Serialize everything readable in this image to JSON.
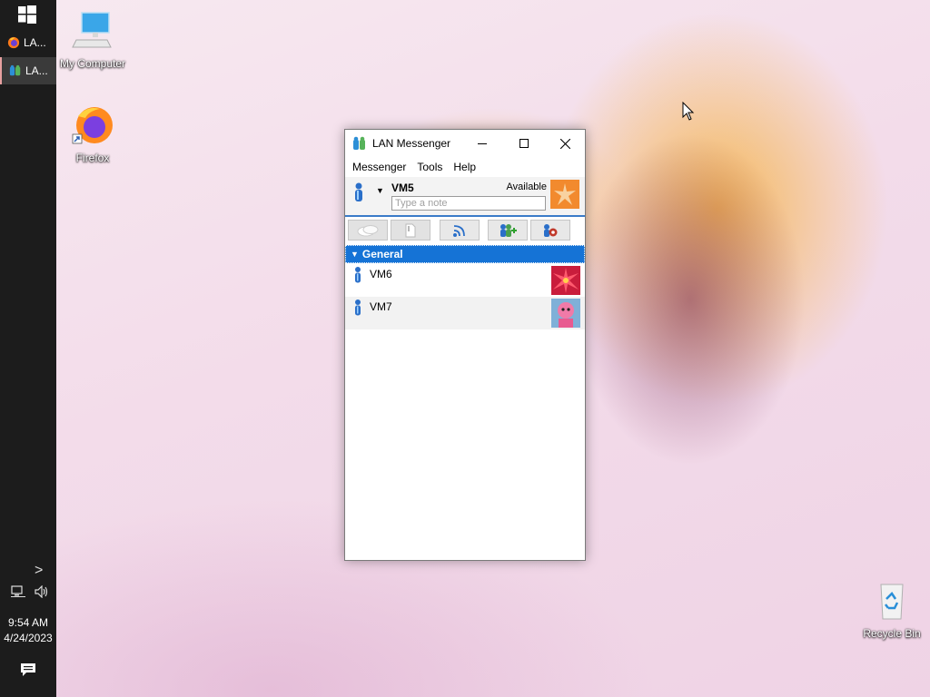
{
  "taskbar": {
    "apps": [
      {
        "label": "LA...",
        "icon": "firefox-icon",
        "active": false
      },
      {
        "label": "LA...",
        "icon": "lan-messenger-icon",
        "active": true
      }
    ],
    "chevron": ">",
    "time": "9:54 AM",
    "date": "4/24/2023"
  },
  "desktop": {
    "icons": [
      {
        "label": "My Computer",
        "icon": "computer-icon"
      },
      {
        "label": "Firefox",
        "icon": "firefox-icon"
      },
      {
        "label": "Recycle Bin",
        "icon": "recycle-bin-icon"
      }
    ]
  },
  "window": {
    "title": "LAN Messenger",
    "menu": [
      "Messenger",
      "Tools",
      "Help"
    ],
    "profile": {
      "name": "VM5",
      "status": "Available",
      "note_placeholder": "Type a note",
      "note_value": ""
    },
    "toolbar_buttons": [
      {
        "name": "chat",
        "icon": "chat-bubble-icon",
        "enabled": false
      },
      {
        "name": "send-file",
        "icon": "file-icon",
        "enabled": false
      },
      {
        "name": "broadcast",
        "icon": "broadcast-icon",
        "enabled": true
      },
      {
        "name": "add-contacts",
        "icon": "add-user-icon",
        "enabled": true
      },
      {
        "name": "settings",
        "icon": "gear-icon",
        "enabled": true
      }
    ],
    "groups": [
      {
        "name": "General",
        "expanded": true,
        "contacts": [
          {
            "name": "VM6",
            "avatar": "red-flower-avatar"
          },
          {
            "name": "VM7",
            "avatar": "pink-figure-avatar"
          }
        ]
      }
    ]
  },
  "colors": {
    "taskbar": "#1c1c1c",
    "accent": "#1573d6",
    "window_border": "#7a7a7a"
  }
}
